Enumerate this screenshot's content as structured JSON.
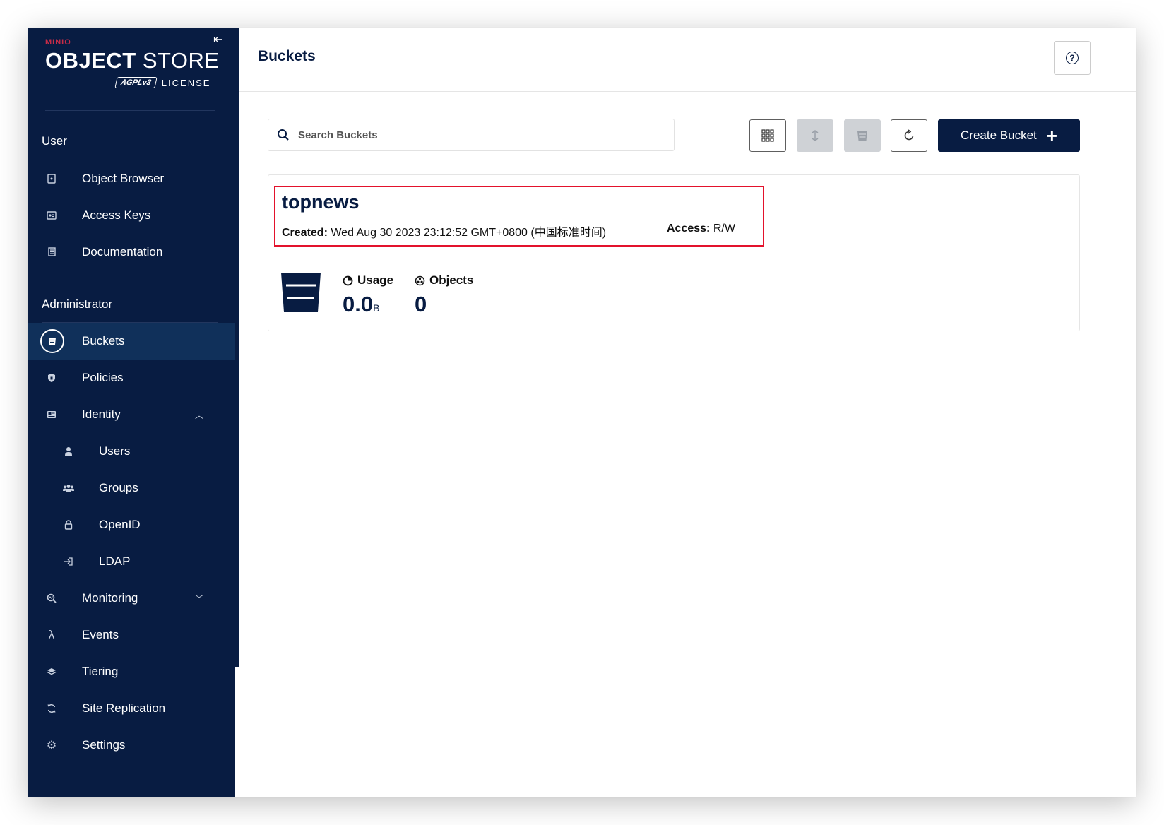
{
  "app": {
    "logo_brand": "MINIO",
    "logo_title_bold": "OBJECT",
    "logo_title_light": "STORE",
    "logo_badge": "AGPLv3",
    "logo_license": "LICENSE"
  },
  "sidebar": {
    "user_section": "User",
    "admin_section": "Administrator",
    "user_items": [
      {
        "label": "Object Browser",
        "icon": "object-browser-icon"
      },
      {
        "label": "Access Keys",
        "icon": "access-keys-icon"
      },
      {
        "label": "Documentation",
        "icon": "documentation-icon"
      }
    ],
    "admin_items": [
      {
        "label": "Buckets",
        "icon": "bucket-icon",
        "active": true
      },
      {
        "label": "Policies",
        "icon": "policy-icon"
      },
      {
        "label": "Identity",
        "icon": "identity-icon",
        "expanded": true
      },
      {
        "label": "Users",
        "icon": "user-icon"
      },
      {
        "label": "Groups",
        "icon": "groups-icon"
      },
      {
        "label": "OpenID",
        "icon": "lock-icon"
      },
      {
        "label": "LDAP",
        "icon": "login-icon"
      },
      {
        "label": "Monitoring",
        "icon": "monitoring-icon",
        "expanded": false
      },
      {
        "label": "Events",
        "icon": "lambda-icon"
      },
      {
        "label": "Tiering",
        "icon": "tiers-icon"
      },
      {
        "label": "Site Replication",
        "icon": "replication-icon"
      },
      {
        "label": "Settings",
        "icon": "gear-icon"
      }
    ]
  },
  "header": {
    "title": "Buckets",
    "help_label": "?"
  },
  "toolbar": {
    "search_placeholder": "Search Buckets",
    "create_label": "Create Bucket"
  },
  "bucket": {
    "name": "topnews",
    "created_label": "Created:",
    "created_value": "Wed Aug 30 2023 23:12:52 GMT+0800 (中国标准时间)",
    "access_label": "Access:",
    "access_value": "R/W",
    "usage_label": "Usage",
    "usage_value": "0.0",
    "usage_unit": "B",
    "objects_label": "Objects",
    "objects_value": "0"
  },
  "colors": {
    "sidebar_bg": "#081c42",
    "accent": "#081c42",
    "highlight": "#e3122c"
  }
}
